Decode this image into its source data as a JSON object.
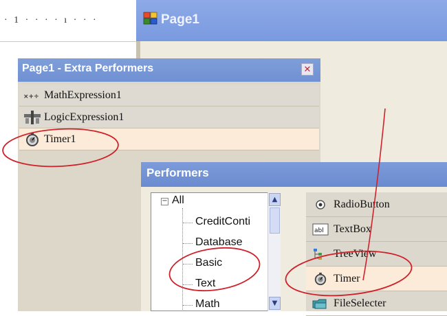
{
  "ruler": {
    "ticks": "· 1 · · · · ı · · ·"
  },
  "page1": {
    "title": "Page1",
    "icon": "form-icon"
  },
  "extra_panel": {
    "title": "Page1 - Extra Performers",
    "close_icon": "close-icon",
    "items": [
      {
        "label": "MathExpression1",
        "icon": "math-expression-icon"
      },
      {
        "label": "LogicExpression1",
        "icon": "logic-expression-icon"
      },
      {
        "label": "Timer1",
        "icon": "timer-icon"
      }
    ]
  },
  "performers": {
    "title": "Performers",
    "tree": {
      "root": "All",
      "expander": "−",
      "items": [
        "CreditConti",
        "Database",
        "Basic",
        "Text",
        "Math"
      ]
    },
    "components": [
      {
        "label": "RadioButton",
        "icon": "radio-button-icon"
      },
      {
        "label": "TextBox",
        "icon": "textbox-icon"
      },
      {
        "label": "TreeView",
        "icon": "treeview-icon"
      },
      {
        "label": "Timer",
        "icon": "timer-icon"
      },
      {
        "label": "FileSelecter",
        "icon": "file-selecter-icon"
      }
    ]
  },
  "colors": {
    "titlebar": "#7a9ae0",
    "selected_row": "#fdebd9",
    "annotation": "#d0202a"
  }
}
